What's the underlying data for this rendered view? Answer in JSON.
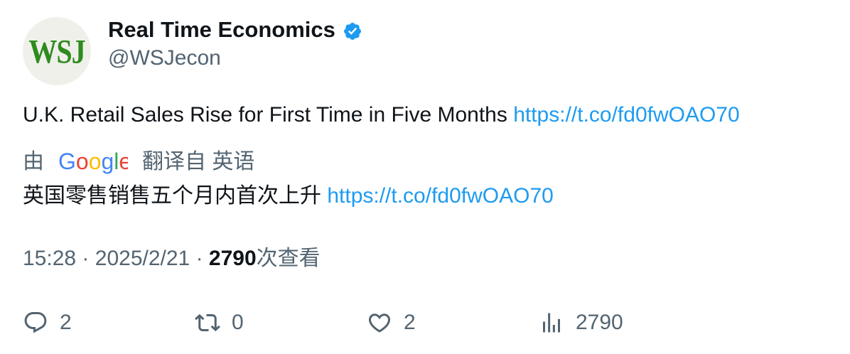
{
  "author": {
    "avatar_text": "WSJ",
    "display_name": "Real Time Economics",
    "handle": "@WSJecon",
    "verified_icon": "verified-badge-icon"
  },
  "tweet": {
    "text": "U.K. Retail Sales Rise for First Time in Five Months",
    "link": "https://t.co/fd0fwOAO70"
  },
  "translation": {
    "by_label": "由",
    "provider_logo": "Google",
    "from_label": "翻译自 英语",
    "text": "英国零售销售五个月内首次上升",
    "link": "https://t.co/fd0fwOAO70"
  },
  "meta": {
    "time": "15:28",
    "separator": "·",
    "date": "2025/2/21",
    "views_count": "2790",
    "views_label": "次查看"
  },
  "actions": {
    "replies": "2",
    "retweets": "0",
    "likes": "2",
    "views": "2790"
  },
  "colors": {
    "link": "#1d9bf0",
    "secondary_text": "#536471",
    "primary_text": "#0f1419",
    "verified": "#1d9bf0",
    "avatar_logo": "#2e8b1e"
  }
}
